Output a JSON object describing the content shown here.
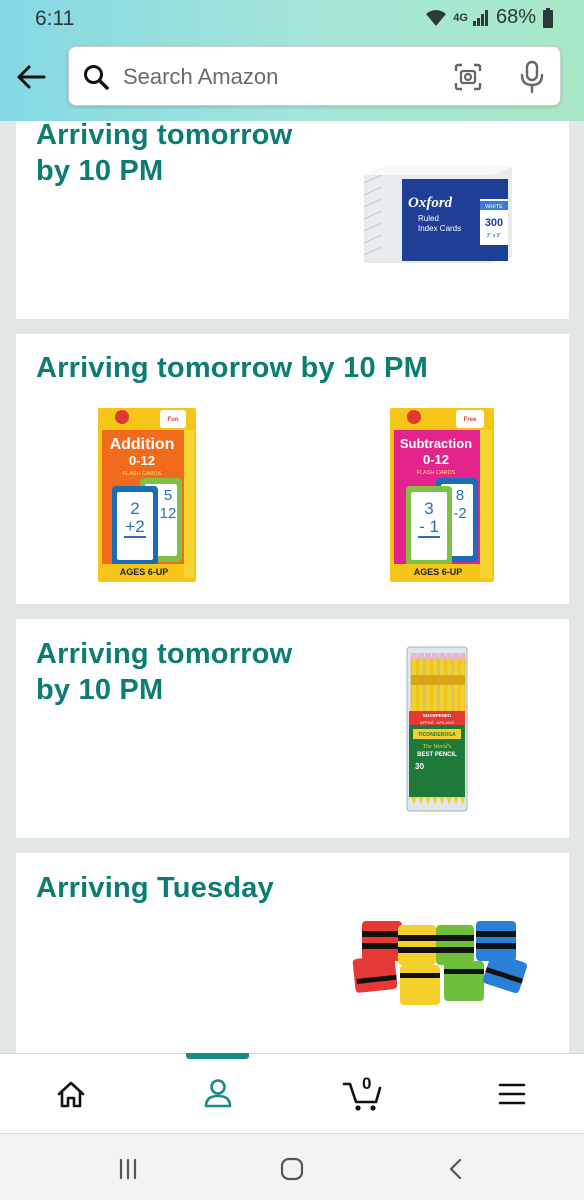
{
  "status_bar": {
    "time": "6:11",
    "network": "4G",
    "battery": "68%"
  },
  "search": {
    "placeholder": "Search Amazon"
  },
  "deliveries": [
    {
      "title_line1": "Arriving tomorrow",
      "title_line2": "by 10 PM",
      "items": [
        "oxford-index-cards-image"
      ]
    },
    {
      "title": "Arriving tomorrow by 10 PM",
      "items": [
        "addition-flash-cards-image",
        "subtraction-flash-cards-image"
      ]
    },
    {
      "title_line1": "Arriving tomorrow",
      "title_line2": "by 10 PM",
      "items": [
        "ticonderoga-pencils-image"
      ]
    },
    {
      "title": "Arriving Tuesday",
      "items": [
        "magnetic-erasers-image"
      ]
    }
  ],
  "products": {
    "oxford": {
      "brand": "Oxford",
      "line1": "Ruled",
      "line2": "Index Cards",
      "tag": "WHITE",
      "count": "300",
      "size": "3\" x 5\""
    },
    "addition": {
      "title": "Addition",
      "range": "0-12",
      "subtitle": "FLASH CARDS",
      "badge": "Fun",
      "top": "2",
      "op": "+2",
      "back_top": "5",
      "back_op": "12",
      "ages": "AGES 6-UP"
    },
    "subtraction": {
      "title": "Subtraction",
      "range": "0-12",
      "subtitle": "FLASH CARDS",
      "badge": "Free",
      "top": "3",
      "op": "- 1",
      "back_top": "8",
      "back_op": "-2",
      "ages": "AGES 6-UP"
    },
    "pencils": {
      "band": "SHARPENED",
      "band2": "AFFILÉ · AFILADO",
      "brand": "TICONDEROGA",
      "tagline1": "The World's",
      "tagline2": "BEST PENCIL",
      "count": "30"
    }
  },
  "bottom_nav": {
    "cart_count": "0",
    "items": [
      "home",
      "account",
      "cart",
      "menu"
    ],
    "active": "account"
  },
  "colors": {
    "accent": "#0b7d73",
    "nav_indicator": "#1a8a8a"
  }
}
